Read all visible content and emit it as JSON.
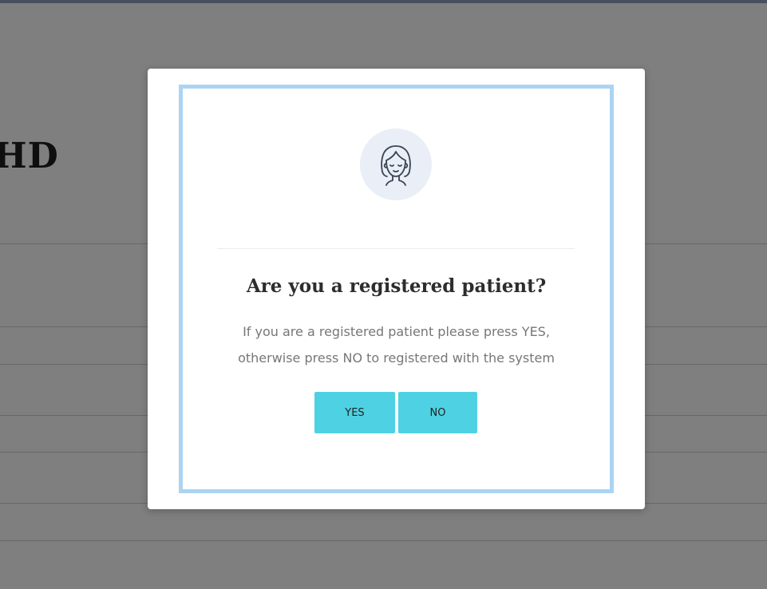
{
  "background": {
    "heading_fragment": "HD"
  },
  "modal": {
    "icon": "woman-face-icon",
    "title": "Are you a registered patient?",
    "message_line1": "If you are a registered patient please press YES,",
    "message_line2": "otherwise press NO to registered with the system",
    "yes_label": "YES",
    "no_label": "NO"
  },
  "colors": {
    "overlay": "#808080",
    "frame_border": "#acd4f2",
    "button": "#4ed2e3",
    "avatar_bg": "#e9eef7"
  }
}
